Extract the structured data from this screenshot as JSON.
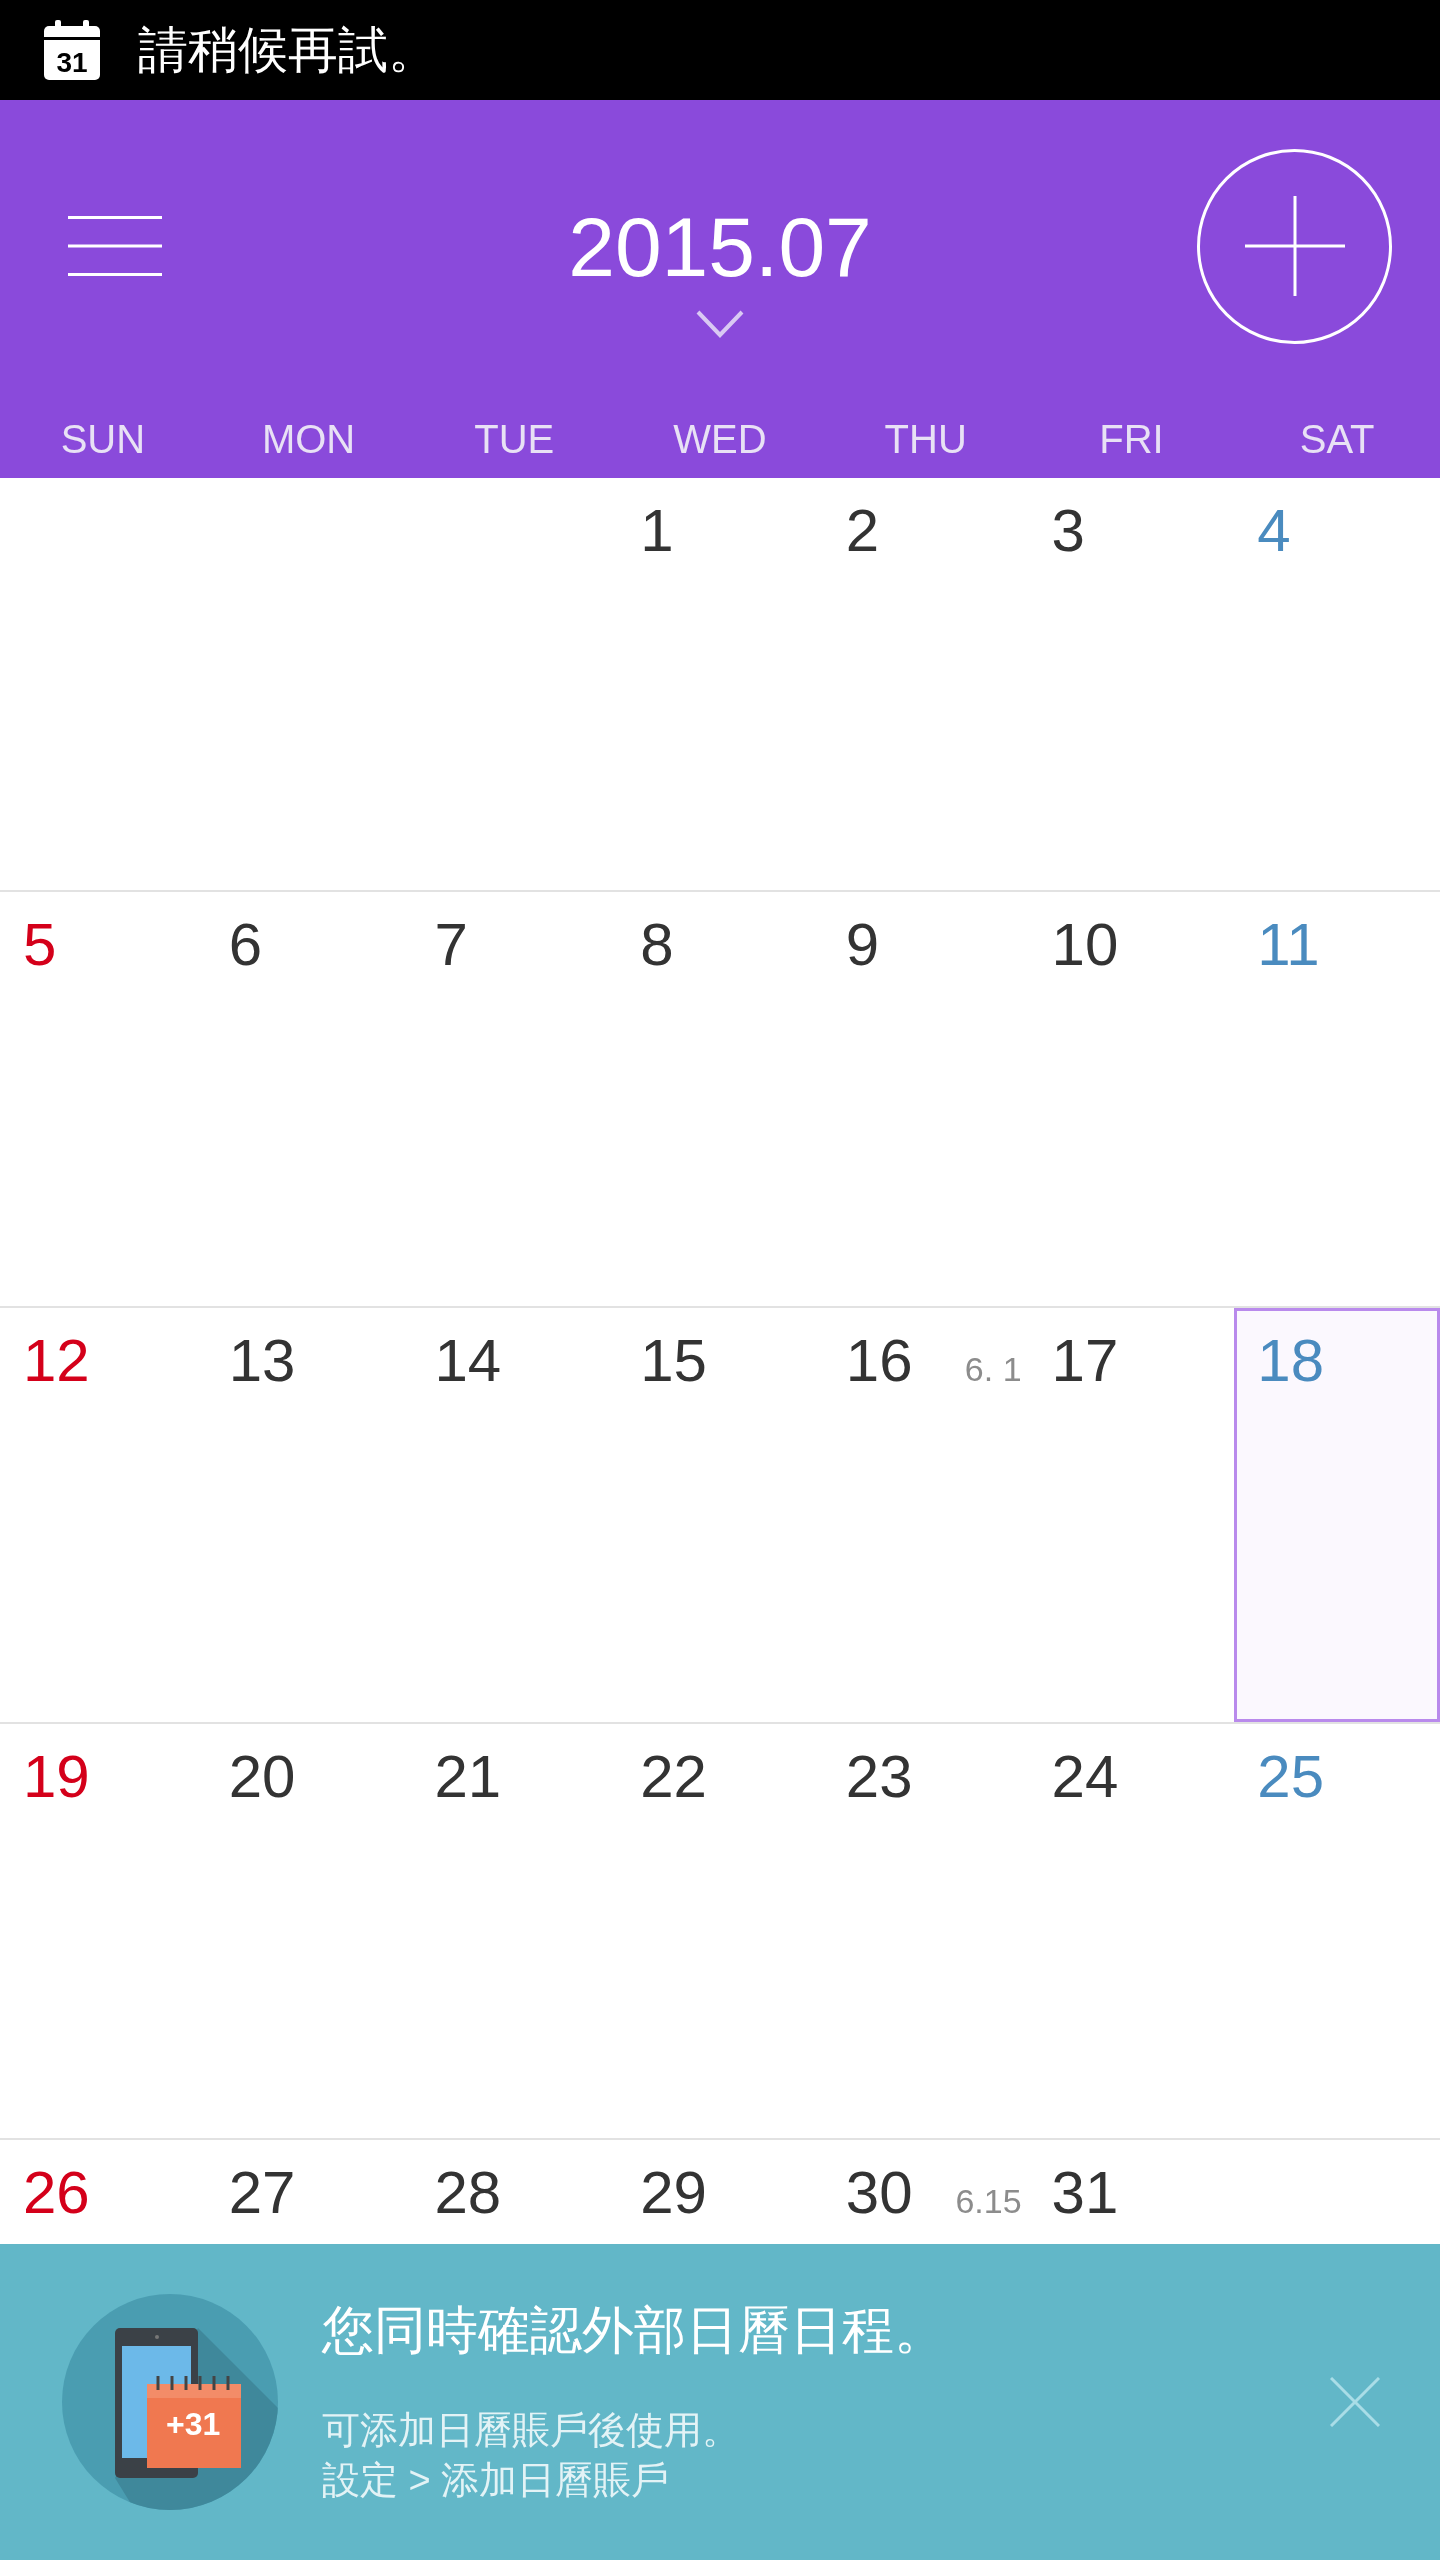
{
  "status_bar": {
    "icon_text": "31",
    "message": "請稍候再試。"
  },
  "header": {
    "title": "2015.07"
  },
  "weekdays": [
    "SUN",
    "MON",
    "TUE",
    "WED",
    "THU",
    "FRI",
    "SAT"
  ],
  "weeks": [
    {
      "days": [
        {
          "kind": "blank"
        },
        {
          "kind": "blank"
        },
        {
          "kind": "blank"
        },
        {
          "kind": "date",
          "number": "1",
          "color": "#333333",
          "selected": false
        },
        {
          "kind": "date",
          "number": "2",
          "color": "#333333",
          "selected": false
        },
        {
          "kind": "date",
          "number": "3",
          "color": "#333333",
          "selected": false
        },
        {
          "kind": "date",
          "number": "4",
          "color": "#4a8bbf",
          "selected": false
        }
      ]
    },
    {
      "days": [
        {
          "kind": "date",
          "number": "5",
          "color": "#d4001a",
          "selected": false
        },
        {
          "kind": "date",
          "number": "6",
          "color": "#333333",
          "selected": false
        },
        {
          "kind": "date",
          "number": "7",
          "color": "#333333",
          "selected": false
        },
        {
          "kind": "date",
          "number": "8",
          "color": "#333333",
          "selected": false
        },
        {
          "kind": "date",
          "number": "9",
          "color": "#333333",
          "selected": false
        },
        {
          "kind": "date",
          "number": "10",
          "color": "#333333",
          "selected": false
        },
        {
          "kind": "date",
          "number": "11",
          "color": "#4a8bbf",
          "selected": false
        }
      ]
    },
    {
      "days": [
        {
          "kind": "date",
          "number": "12",
          "color": "#d4001a",
          "selected": false
        },
        {
          "kind": "date",
          "number": "13",
          "color": "#333333",
          "selected": false
        },
        {
          "kind": "date",
          "number": "14",
          "color": "#333333",
          "selected": false
        },
        {
          "kind": "date",
          "number": "15",
          "color": "#333333",
          "selected": false
        },
        {
          "kind": "date",
          "number": "16",
          "color": "#333333",
          "selected": false,
          "lunar": "6. 1"
        },
        {
          "kind": "date",
          "number": "17",
          "color": "#333333",
          "selected": false
        },
        {
          "kind": "date",
          "number": "18",
          "color": "#4a8bbf",
          "selected": true
        }
      ]
    },
    {
      "days": [
        {
          "kind": "date",
          "number": "19",
          "color": "#d4001a",
          "selected": false
        },
        {
          "kind": "date",
          "number": "20",
          "color": "#333333",
          "selected": false
        },
        {
          "kind": "date",
          "number": "21",
          "color": "#333333",
          "selected": false
        },
        {
          "kind": "date",
          "number": "22",
          "color": "#333333",
          "selected": false
        },
        {
          "kind": "date",
          "number": "23",
          "color": "#333333",
          "selected": false
        },
        {
          "kind": "date",
          "number": "24",
          "color": "#333333",
          "selected": false
        },
        {
          "kind": "date",
          "number": "25",
          "color": "#4a8bbf",
          "selected": false
        }
      ]
    },
    {
      "days": [
        {
          "kind": "date",
          "number": "26",
          "color": "#d4001a",
          "selected": false
        },
        {
          "kind": "date",
          "number": "27",
          "color": "#333333",
          "selected": false
        },
        {
          "kind": "date",
          "number": "28",
          "color": "#333333",
          "selected": false
        },
        {
          "kind": "date",
          "number": "29",
          "color": "#333333",
          "selected": false
        },
        {
          "kind": "date",
          "number": "30",
          "color": "#333333",
          "selected": false,
          "lunar": "6.15"
        },
        {
          "kind": "date",
          "number": "31",
          "color": "#333333",
          "selected": false
        },
        {
          "kind": "blank"
        }
      ]
    }
  ],
  "banner": {
    "icon_text": "+31",
    "title": "您同時確認外部日曆日程。",
    "lines": [
      "可添加日曆賬戶後使用。",
      "設定 > 添加日曆賬戶"
    ]
  }
}
